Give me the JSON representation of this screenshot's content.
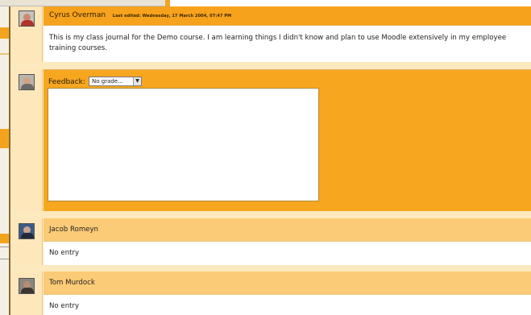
{
  "entries": [
    {
      "name": "Cyrus Overman",
      "last_edited": "Last edited: Wednesday, 17 March 2004, 07:47 PM",
      "text": "This is my class journal for the Demo course. I am learning things I didn't know and plan to use Moodle extensively in my employee training courses."
    }
  ],
  "feedback": {
    "label": "Feedback:",
    "grade_selected": "No grade..."
  },
  "others": [
    {
      "name": "Jacob Romeyn",
      "entry_text": "No entry"
    },
    {
      "name": "Tom Murdock",
      "entry_text": "No entry"
    }
  ],
  "colors": {
    "header_orange": "#f6a21c",
    "panel_cream": "#fde9be",
    "row_header": "#fccb77"
  }
}
